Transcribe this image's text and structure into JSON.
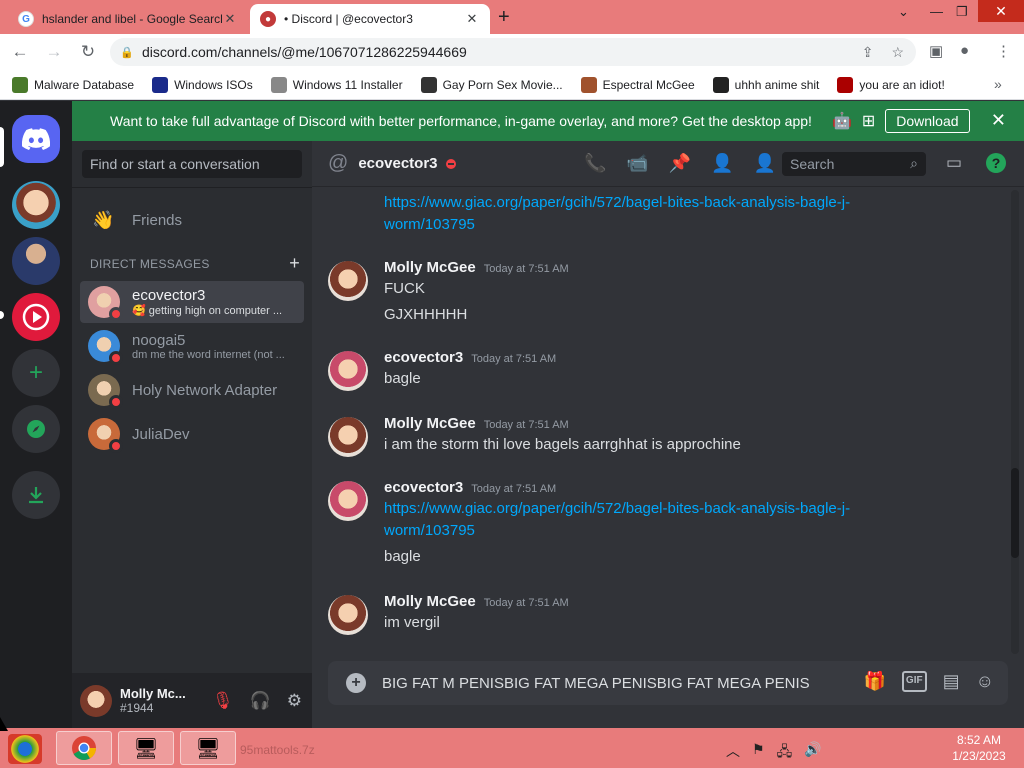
{
  "browser": {
    "tabs": [
      {
        "title": "hslander and libel - Google Search",
        "close": "✕",
        "active": false
      },
      {
        "title": "• Discord | @ecovector3",
        "close": "✕",
        "active": true
      }
    ],
    "new_tab": "+",
    "url": "discord.com/channels/@me/1067071286225944669",
    "bookmarks": [
      {
        "label": "Malware Database",
        "icon": "malware-icon",
        "color": "#4a7a2a"
      },
      {
        "label": "Windows ISOs",
        "icon": "x-icon",
        "color": "#1a2a8a"
      },
      {
        "label": "Windows 11 Installer",
        "icon": "wrench-icon",
        "color": "#888888"
      },
      {
        "label": "Gay Porn Sex Movie...",
        "icon": "skull-icon",
        "color": "#333333"
      },
      {
        "label": "Espectral McGee",
        "icon": "avatar-icon",
        "color": "#a0522d"
      },
      {
        "label": "uhhh anime shit",
        "icon": "anime-icon",
        "color": "#222222"
      },
      {
        "label": "you are an idiot!",
        "icon": "idiot-icon",
        "color": "#aa0000"
      }
    ],
    "bookmarks_more": "»"
  },
  "banner": {
    "text": "Want to take full advantage of Discord with better performance, in-game overlay, and more? Get the desktop app!",
    "button": "Download",
    "close": "✕"
  },
  "sidebar": {
    "search_placeholder": "Find or start a conversation",
    "friends_label": "Friends",
    "dm_header": "DIRECT MESSAGES",
    "dm_add": "+",
    "dms": [
      {
        "name": "ecovector3",
        "sub": "🥰 getting high on computer ...",
        "selected": true,
        "color": "#e0a0a0"
      },
      {
        "name": "noogai5",
        "sub": "dm me the word internet (not ...",
        "selected": false,
        "color": "#3a8ad8"
      },
      {
        "name": "Holy Network Adapter",
        "sub": "",
        "selected": false,
        "color": "#7a6a50"
      },
      {
        "name": "JuliaDev",
        "sub": "",
        "selected": false,
        "color": "#c86a3a"
      }
    ]
  },
  "user_panel": {
    "name": "Molly Mc...",
    "tag": "#1944"
  },
  "chat": {
    "recipient": "ecovector3",
    "search_placeholder": "Search",
    "help": "?",
    "messages": [
      {
        "type": "continuation",
        "lines": [
          {
            "kind": "link",
            "text": "https://www.giac.org/paper/gcih/572/bagel-bites-back-analysis-bagle-j-"
          },
          {
            "kind": "link",
            "text": "worm/103795"
          }
        ]
      },
      {
        "author": "Molly McGee",
        "time": "Today at 7:51 AM",
        "lines": [
          {
            "kind": "text",
            "text": "FUCK"
          },
          {
            "kind": "text",
            "text": "GJXHHHHH"
          }
        ]
      },
      {
        "author": "ecovector3",
        "time": "Today at 7:51 AM",
        "lines": [
          {
            "kind": "text",
            "text": "bagle"
          }
        ]
      },
      {
        "author": "Molly McGee",
        "time": "Today at 7:51 AM",
        "lines": [
          {
            "kind": "text",
            "text": "i am the storm thi love bagels aarrghhat is approchine"
          }
        ]
      },
      {
        "author": "ecovector3",
        "time": "Today at 7:51 AM",
        "lines": [
          {
            "kind": "link",
            "text": "https://www.giac.org/paper/gcih/572/bagel-bites-back-analysis-bagle-j-"
          },
          {
            "kind": "link",
            "text": "worm/103795"
          },
          {
            "kind": "text",
            "text": "bagle"
          }
        ]
      },
      {
        "author": "Molly McGee",
        "time": "Today at 7:51 AM",
        "lines": [
          {
            "kind": "text",
            "text": "im vergil"
          }
        ]
      }
    ],
    "composer_text": "BIG FAT M PENISBIG FAT MEGA PENISBIG FAT MEGA PENIS"
  },
  "taskbar": {
    "ghost_text": "95mattools.7z",
    "clock_time": "8:52 AM",
    "clock_date": "1/23/2023"
  },
  "colors": {
    "blurple": "#5865f2",
    "green": "#23a55a",
    "dnd_red": "#f23f43",
    "link": "#00a8fc",
    "chrome_accent": "#e87b7b"
  }
}
